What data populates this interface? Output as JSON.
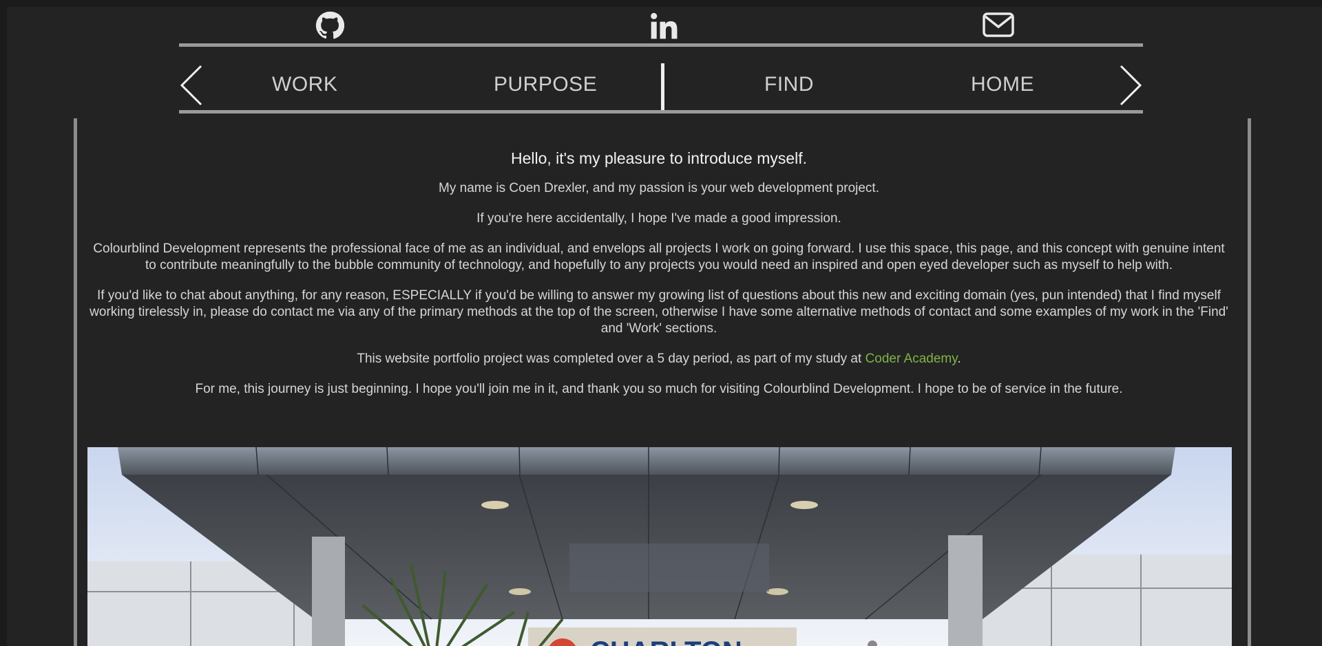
{
  "social": {
    "github_icon": "github-icon",
    "linkedin_icon": "linkedin-icon",
    "mail_icon": "envelope-icon"
  },
  "nav": {
    "items": [
      "WORK",
      "PURPOSE",
      "FIND",
      "HOME"
    ],
    "prev_icon": "chevron-left-icon",
    "next_icon": "chevron-right-icon"
  },
  "content": {
    "heading": "Hello, it's my pleasure to introduce myself.",
    "p1": "My name is Coen Drexler, and my passion is your web development project.",
    "p2": "If you're here accidentally, I hope I've made a good impression.",
    "p3": "Colourblind Development represents the professional face of me as an individual, and envelops all projects I work on going forward. I use this space, this page, and this concept with genuine intent to contribute meaningfully to the bubble community of technology, and hopefully to any projects you would need an inspired and open eyed developer such as myself to help with.",
    "p4": "If you'd like to chat about anything, for any reason, ESPECIALLY if you'd be willing to answer my growing list of questions about this new and exciting domain (yes, pun intended) that I find myself working tirelessly in, please do contact me via any of the primary methods at the top of the screen, otherwise I have some alternative methods of contact and some examples of my work in the 'Find' and 'Work' sections.",
    "p5_before": "This website portfolio project was completed over a 5 day period, as part of my study at ",
    "p5_link": "Coder Academy",
    "p5_after": ".",
    "p6": "For me, this journey is just beginning. I hope you'll join me in it, and thank you so much for visiting Colourblind Development. I hope to be of service in the future.",
    "photo_sign": "CHARLTON"
  },
  "colors": {
    "background": "#232323",
    "rule": "#9a9a9a",
    "link": "#7fb447"
  }
}
